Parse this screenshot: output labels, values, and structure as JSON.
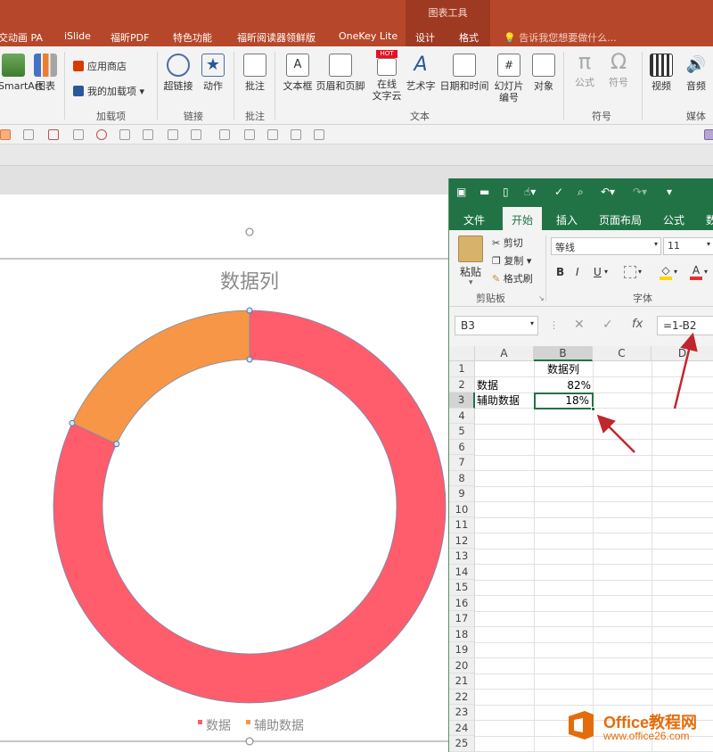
{
  "ppt": {
    "context_tab_group": "图表工具",
    "tabs": [
      "交动画 PA",
      "iSlide",
      "福昕PDF",
      "特色功能",
      "福昕阅读器领鲜版",
      "OneKey Lite",
      "设计",
      "格式"
    ],
    "tell_me": "告诉我您想要做什么...",
    "ribbon": {
      "smartart": "SmartArt",
      "chart": "图表",
      "app_store": "应用商店",
      "my_addins": "我的加载项",
      "addins_group": "加载项",
      "hyperlink": "超链接",
      "action": "动作",
      "links_group": "链接",
      "comment": "批注",
      "comments_group": "批注",
      "textbox": "文本框",
      "header_footer": "页眉和页脚",
      "online_word_cloud_1": "在线",
      "online_word_cloud_2": "文字云",
      "hot_badge": "HOT",
      "wordart": "艺术字",
      "date_time": "日期和时间",
      "slide_number_1": "幻灯片",
      "slide_number_2": "编号",
      "object": "对象",
      "text_group": "文本",
      "equation": "公式",
      "symbol": "符号",
      "symbols_group": "符号",
      "video": "视频",
      "audio": "音频",
      "media_group": "媒体"
    }
  },
  "chart_data": {
    "type": "pie",
    "title": "数据列",
    "categories": [
      "数据",
      "辅助数据"
    ],
    "values": [
      0.82,
      0.18
    ],
    "colors": [
      "#ff5d6c",
      "#f79646"
    ],
    "donut": true,
    "legend": "bottom"
  },
  "excel": {
    "tabs": [
      "文件",
      "开始",
      "插入",
      "页面布局",
      "公式",
      "数"
    ],
    "active_tab": "开始",
    "clipboard": {
      "paste": "粘贴",
      "cut": "剪切",
      "copy": "复制",
      "format_painter": "格式刷",
      "group": "剪贴板"
    },
    "font": {
      "name": "等线",
      "size": "11",
      "bold": "B",
      "italic": "I",
      "underline": "U",
      "group": "字体"
    },
    "name_box": "B3",
    "formula": "=1-B2",
    "columns": [
      "A",
      "B",
      "C",
      "D"
    ],
    "rows": [
      "1",
      "2",
      "3",
      "4",
      "5",
      "6",
      "7",
      "8",
      "9",
      "10",
      "11",
      "12",
      "13",
      "14",
      "15",
      "16",
      "17",
      "18",
      "19",
      "20",
      "21",
      "22",
      "23",
      "24",
      "25"
    ],
    "cells": {
      "B1": "数据列",
      "A2": "数据",
      "B2": "82%",
      "A3": "辅助数据",
      "B3": "18%"
    }
  },
  "watermark": {
    "title": "Office教程网",
    "url": "www.office26.com"
  }
}
